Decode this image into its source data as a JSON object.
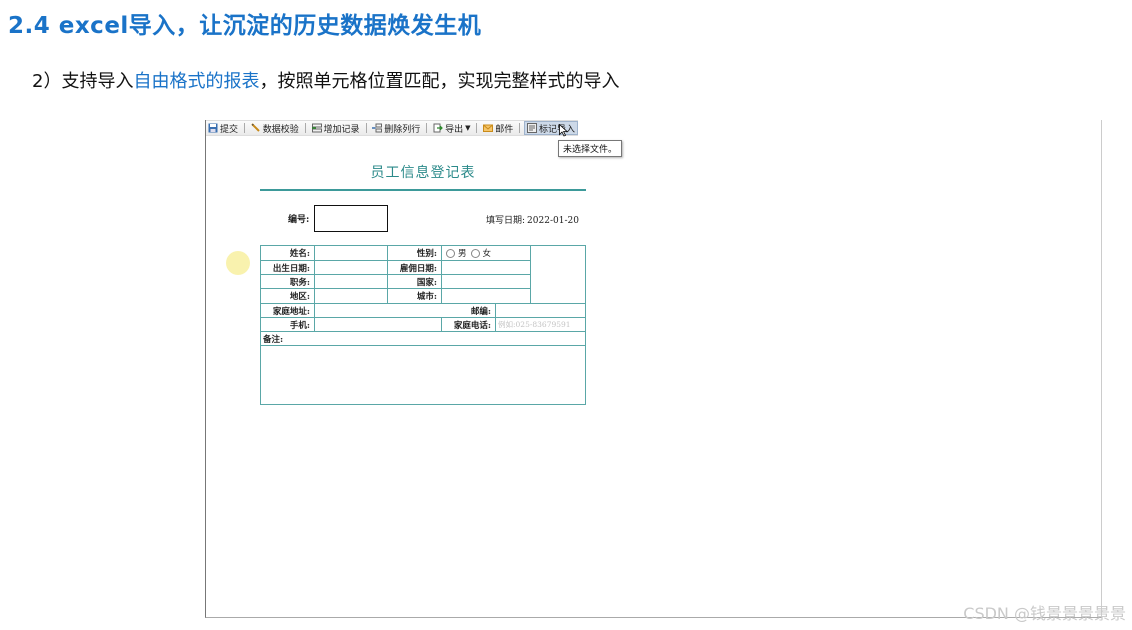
{
  "slide": {
    "title": "2.4 excel导入，让沉淀的历史数据焕发生机",
    "subtitle_prefix": "2）支持导入",
    "subtitle_highlight": "自由格式的报表",
    "subtitle_suffix": "，按照单元格位置匹配，实现完整样式的导入"
  },
  "toolbar": {
    "submit": "提交",
    "validate": "数据校验",
    "add_record": "增加记录",
    "delete_row": "删除列行",
    "export": "导出",
    "mail": "邮件",
    "tag_import": "标记导入"
  },
  "tooltip": "未选择文件。",
  "form": {
    "title": "员工信息登记表",
    "serial_label": "编号:",
    "fill_date_label": "填写日期:",
    "fill_date_value": "2022-01-20",
    "name": "姓名:",
    "gender": "性别:",
    "male": "男",
    "female": "女",
    "birth_date": "出生日期:",
    "hire_date": "雇佣日期:",
    "position": "职务:",
    "country": "国家:",
    "region": "地区:",
    "city": "城市:",
    "home_address": "家庭地址:",
    "postal_code": "邮编:",
    "mobile": "手机:",
    "home_phone": "家庭电话:",
    "home_phone_placeholder": "例如:025-83679591",
    "remarks": "备注:"
  },
  "watermark": "CSDN @钱景景景景景",
  "colors": {
    "accent": "#1a73c8",
    "form_teal": "#2b8a8a"
  }
}
